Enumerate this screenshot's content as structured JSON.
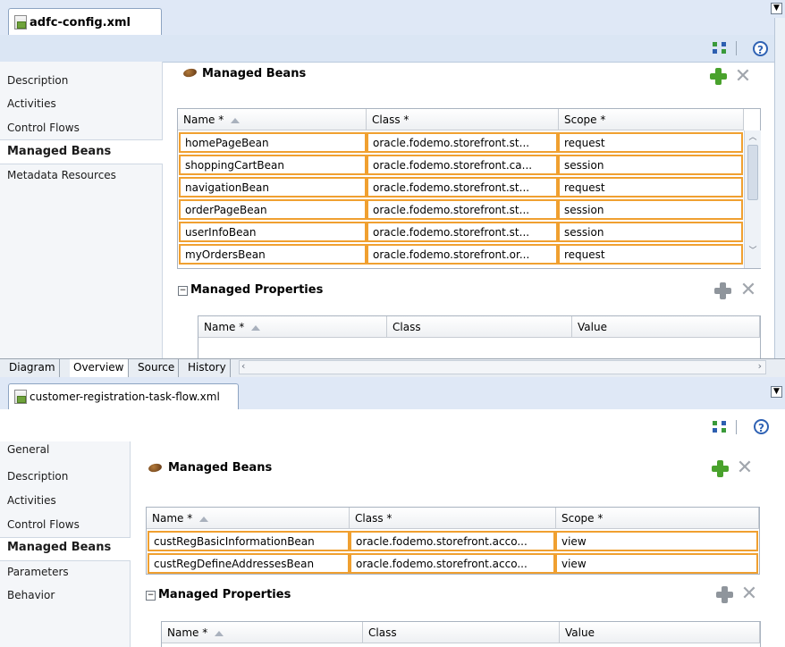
{
  "top_editor": {
    "tab_title": "adfc-config.xml",
    "nav_items": [
      "Description",
      "Activities",
      "Control Flows",
      "Managed Beans",
      "Metadata Resources"
    ],
    "active_nav": "Managed Beans",
    "section_title": "Managed Beans",
    "columns": [
      "Name *",
      "Class *",
      "Scope *"
    ],
    "rows": [
      {
        "name": "homePageBean",
        "class": "oracle.fodemo.storefront.st...",
        "scope": "request"
      },
      {
        "name": "shoppingCartBean",
        "class": "oracle.fodemo.storefront.ca...",
        "scope": "session"
      },
      {
        "name": "navigationBean",
        "class": "oracle.fodemo.storefront.st...",
        "scope": "request"
      },
      {
        "name": "orderPageBean",
        "class": "oracle.fodemo.storefront.st...",
        "scope": "session"
      },
      {
        "name": "userInfoBean",
        "class": "oracle.fodemo.storefront.st...",
        "scope": "session"
      },
      {
        "name": "myOrdersBean",
        "class": "oracle.fodemo.storefront.or...",
        "scope": "request"
      }
    ],
    "properties_title": "Managed Properties",
    "property_columns": [
      "Name *",
      "Class",
      "Value"
    ],
    "bottom_tabs": [
      "Diagram",
      "Overview",
      "Source",
      "History"
    ],
    "active_bottom_tab": "Overview"
  },
  "bottom_editor": {
    "tab_title": "customer-registration-task-flow.xml",
    "nav_items": [
      "General",
      "Description",
      "Activities",
      "Control Flows",
      "Managed Beans",
      "Parameters",
      "Behavior"
    ],
    "active_nav": "Managed Beans",
    "section_title": "Managed Beans",
    "columns": [
      "Name *",
      "Class *",
      "Scope *"
    ],
    "rows": [
      {
        "name": "custRegBasicInformationBean",
        "class": "oracle.fodemo.storefront.acco...",
        "scope": "view"
      },
      {
        "name": "custRegDefineAddressesBean",
        "class": "oracle.fodemo.storefront.acco...",
        "scope": "view"
      }
    ],
    "properties_title": "Managed Properties",
    "property_columns": [
      "Name *",
      "Class",
      "Value"
    ]
  },
  "icons": {
    "add": "add-icon",
    "remove": "remove-icon",
    "help": "help-icon",
    "structure": "structure-icon",
    "bean": "managed-bean-icon"
  },
  "colors": {
    "selection_border": "#f0a030",
    "add_green": "#49a22c",
    "tab_strip": "#dfe8f6"
  }
}
